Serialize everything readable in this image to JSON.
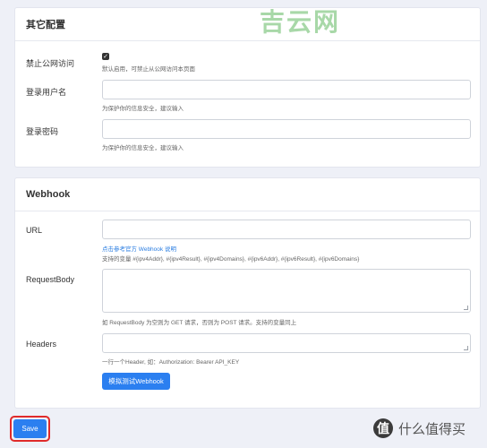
{
  "watermark": "吉云网",
  "other_config": {
    "title": "其它配置",
    "disable_public": {
      "label": "禁止公网访问",
      "checked": true,
      "help": "默认启用，可禁止从公网访问本页面"
    },
    "username": {
      "label": "登录用户名",
      "value": "",
      "help": "为保护你的信息安全，建议输入"
    },
    "password": {
      "label": "登录密码",
      "value": "",
      "help": "为保护你的信息安全，建议输入"
    }
  },
  "webhook": {
    "title": "Webhook",
    "url": {
      "label": "URL",
      "value": "",
      "link": "点击参考官方 Webhook 说明",
      "help": "支持的变量 #{ipv4Addr}, #{ipv4Result}, #{ipv4Domains}, #{ipv6Addr}, #{ipv6Result}, #{ipv6Domains}"
    },
    "request_body": {
      "label": "RequestBody",
      "value": "",
      "help": "如 RequestBody 为空则为 GET 请求，否则为 POST 请求。支持的变量同上"
    },
    "headers": {
      "label": "Headers",
      "value": "",
      "help": "一行一个Header, 如：Authorization: Bearer API_KEY"
    },
    "test_button": "模拟测试Webhook"
  },
  "save_button": "Save",
  "corner_brand": {
    "logo": "值",
    "text": "什么值得买"
  }
}
